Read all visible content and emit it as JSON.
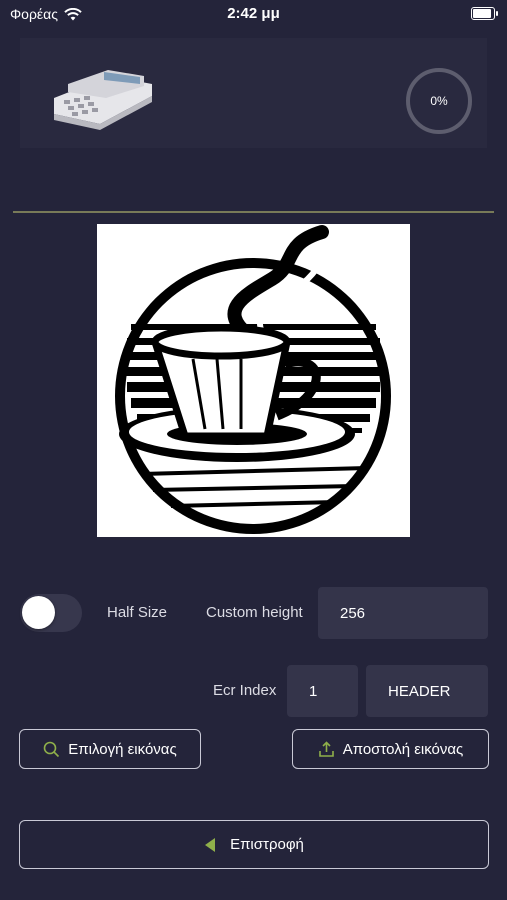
{
  "status_bar": {
    "carrier": "Φορέας",
    "time": "2:42 μμ"
  },
  "progress": {
    "label": "0%",
    "value": 0
  },
  "controls": {
    "half_size_label": "Half Size",
    "half_size_on": false,
    "custom_height_label": "Custom height",
    "custom_height_value": "256",
    "ecr_index_label": "Ecr Index",
    "ecr_index_value": "1",
    "section_value": "HEADER"
  },
  "buttons": {
    "select_image": "Επιλογή εικόνας",
    "send_image": "Αποστολή εικόνας",
    "back": "Επιστροφή"
  },
  "icons": {
    "wifi": "wifi-icon",
    "battery": "battery-icon",
    "device": "cash-register-icon",
    "search": "search-icon",
    "upload": "upload-icon",
    "back": "back-triangle-icon"
  },
  "colors": {
    "background": "#24243a",
    "accent": "#8fb04a",
    "divider": "#787a58"
  }
}
